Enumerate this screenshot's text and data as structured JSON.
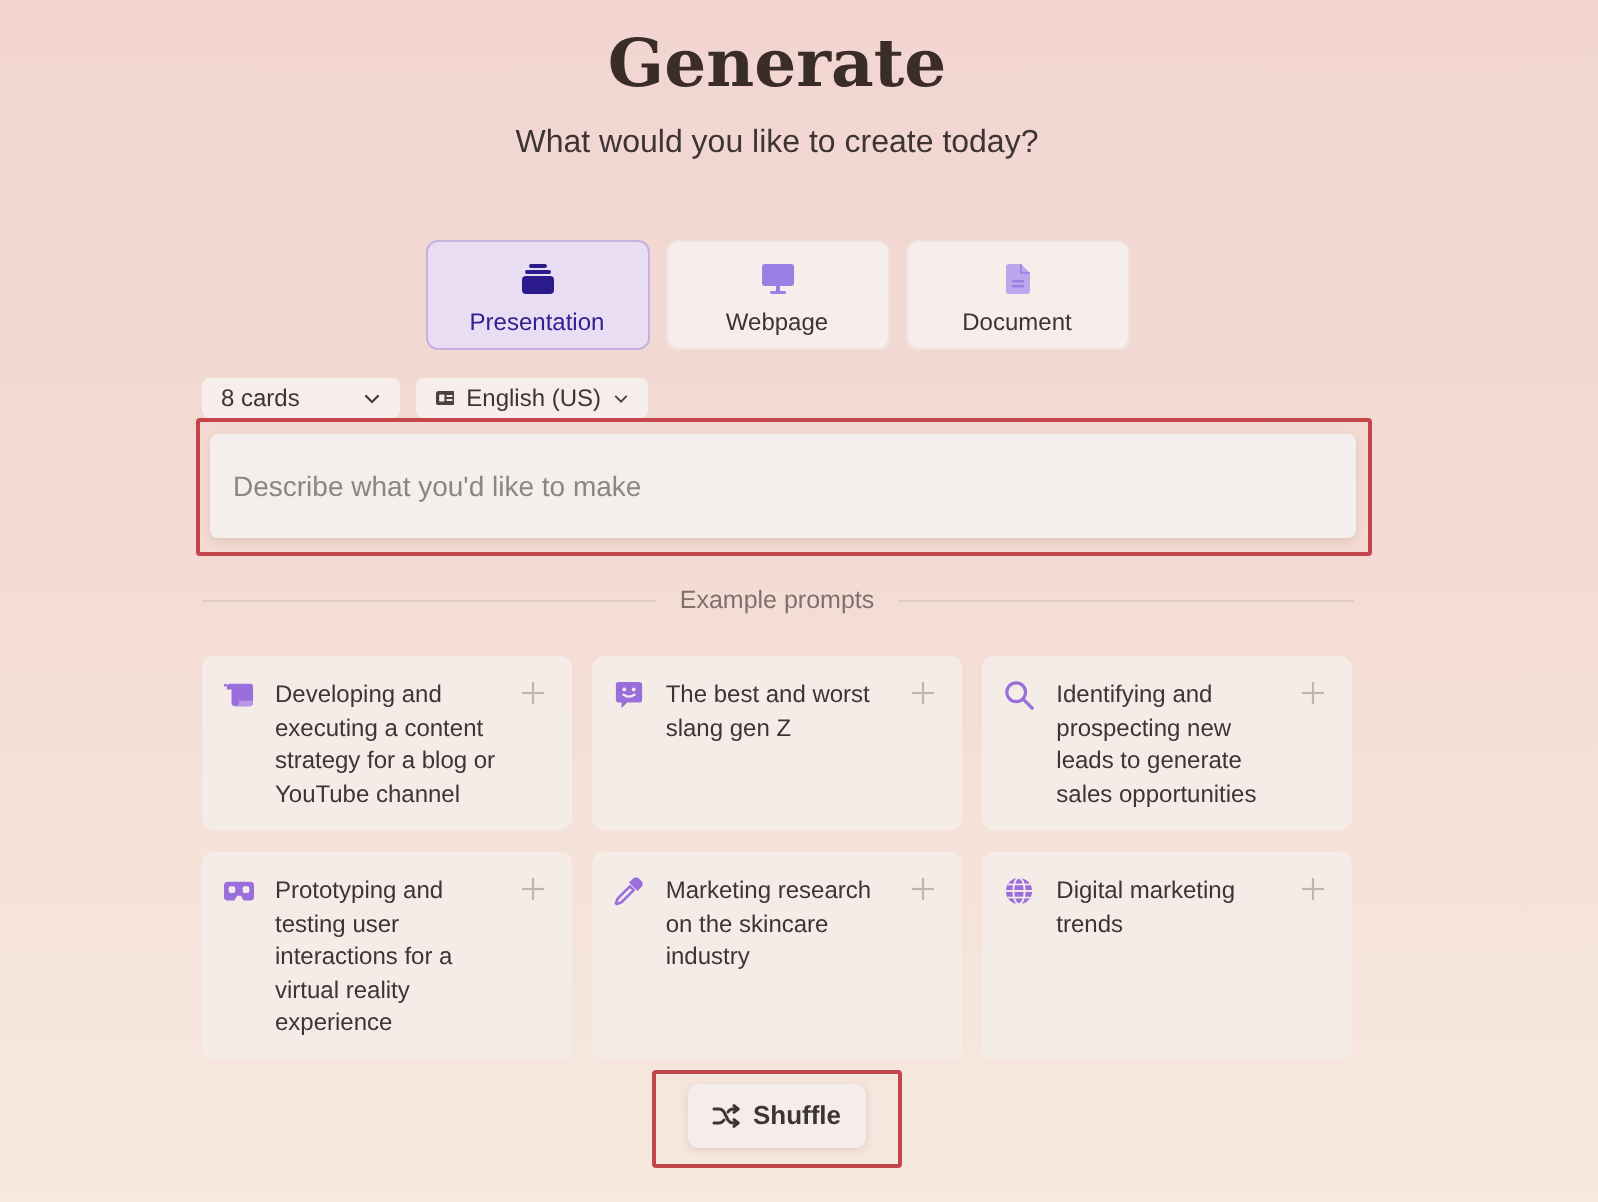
{
  "header": {
    "title": "Generate",
    "subtitle": "What would you like to create today?"
  },
  "formats": [
    {
      "kind": "presentation",
      "label": "Presentation",
      "selected": true
    },
    {
      "kind": "webpage",
      "label": "Webpage",
      "selected": false
    },
    {
      "kind": "document",
      "label": "Document",
      "selected": false
    }
  ],
  "options": [
    {
      "kind": "cards",
      "value": "8 cards"
    },
    {
      "kind": "language",
      "value": "English (US)"
    }
  ],
  "prompt_input": {
    "placeholder": "Describe what you'd like to make",
    "highlighted": true
  },
  "examples": {
    "heading": "Example prompts",
    "items": [
      {
        "kind": "blog",
        "text": "Developing and executing a content strategy for a blog or YouTube channel"
      },
      {
        "kind": "chat",
        "text": "The best and worst slang gen Z"
      },
      {
        "kind": "search",
        "text": "Identifying and prospecting new leads to generate sales opportunities"
      },
      {
        "kind": "vr",
        "text": "Prototyping and testing user interactions for a virtual reality experience"
      },
      {
        "kind": "pipette",
        "text": "Marketing research on the skincare industry"
      },
      {
        "kind": "globe",
        "text": "Digital marketing trends"
      }
    ]
  },
  "shuffle_button": {
    "label": "Shuffle",
    "highlighted": true
  }
}
